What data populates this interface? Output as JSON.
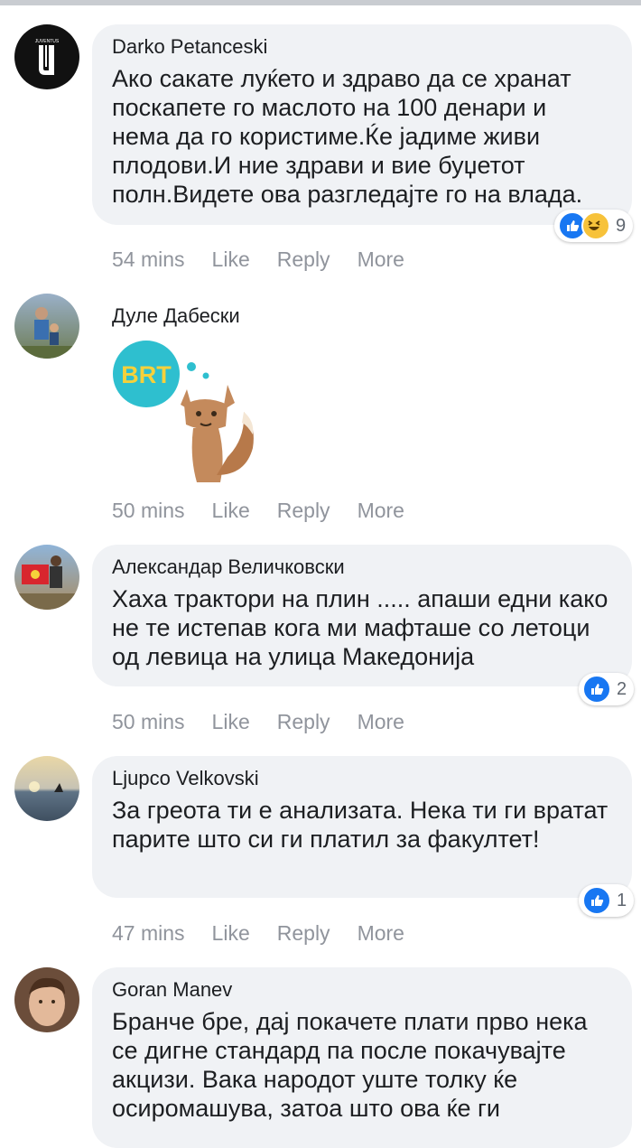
{
  "comments": [
    {
      "name": "Darko Petanceski",
      "text": "Ако сакате луќето и здраво да се хранат поскапете го маслото на 100 денари и нема да го користиме.Ќе јадиме живи плодови.И ние здрави и вие буџетот полн.Видете ова разгледајте го на влада.",
      "time": "54 mins",
      "reaction_count": "9",
      "avatar_text": "JUVENTUS"
    },
    {
      "name": "Дуле Дабески",
      "sticker_text": "BRT",
      "time": "50 mins"
    },
    {
      "name": "Александар Величковски",
      "text": "Хаха трактори на плин ..... апаши едни како не те истепав кога ми мафташе со летоци од левица на улица Македонија",
      "time": "50 mins",
      "reaction_count": "2"
    },
    {
      "name": "Ljupco Velkovski",
      "text": "За греота ти е анализата. Нека ти ги вратат парите што си ги платил за факултет!",
      "time": "47 mins",
      "reaction_count": "1"
    },
    {
      "name": "Goran Manev",
      "text": "Бранче бре, дај покачете плати прво нека се дигне стандард па после покачувајте акцизи. Вака народот уште толку ќе осиромашува, затоа што ова ќе ги"
    }
  ],
  "actions": {
    "like": "Like",
    "reply": "Reply",
    "more": "More"
  },
  "colors": {
    "bubble": "#f0f2f5",
    "like_blue": "#1877f2",
    "meta_gray": "#90949c"
  }
}
